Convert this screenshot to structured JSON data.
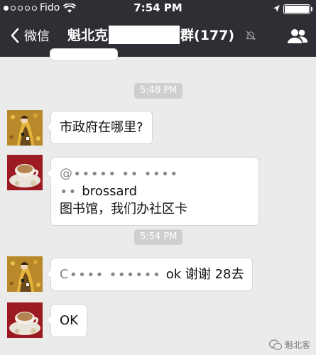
{
  "status_bar": {
    "carrier": "Fido",
    "time": "7:54 PM"
  },
  "nav": {
    "back_label": "微信",
    "group_title_left": "魁北克",
    "group_title_right": "群(177)"
  },
  "messages": [
    {
      "type": "time",
      "text": "5:48 PM"
    },
    {
      "type": "incoming",
      "avatar": "painting-avatar",
      "text": "市政府在哪里?"
    },
    {
      "type": "incoming",
      "avatar": "teacup-avatar",
      "line1_visible": "brossard",
      "line2": "图书馆，我们办社区卡"
    },
    {
      "type": "time",
      "text": "5:54 PM"
    },
    {
      "type": "incoming",
      "avatar": "painting-avatar",
      "text_visible": "ok 谢谢 28去"
    },
    {
      "type": "incoming",
      "avatar": "teacup-avatar",
      "text": "OK"
    }
  ],
  "watermark": {
    "text": "魁北客"
  },
  "colors": {
    "topbar": "#2f2e34",
    "chat_bg": "#ebebeb",
    "bubble": "#ffffff",
    "timechip": "#cfcfcf"
  }
}
